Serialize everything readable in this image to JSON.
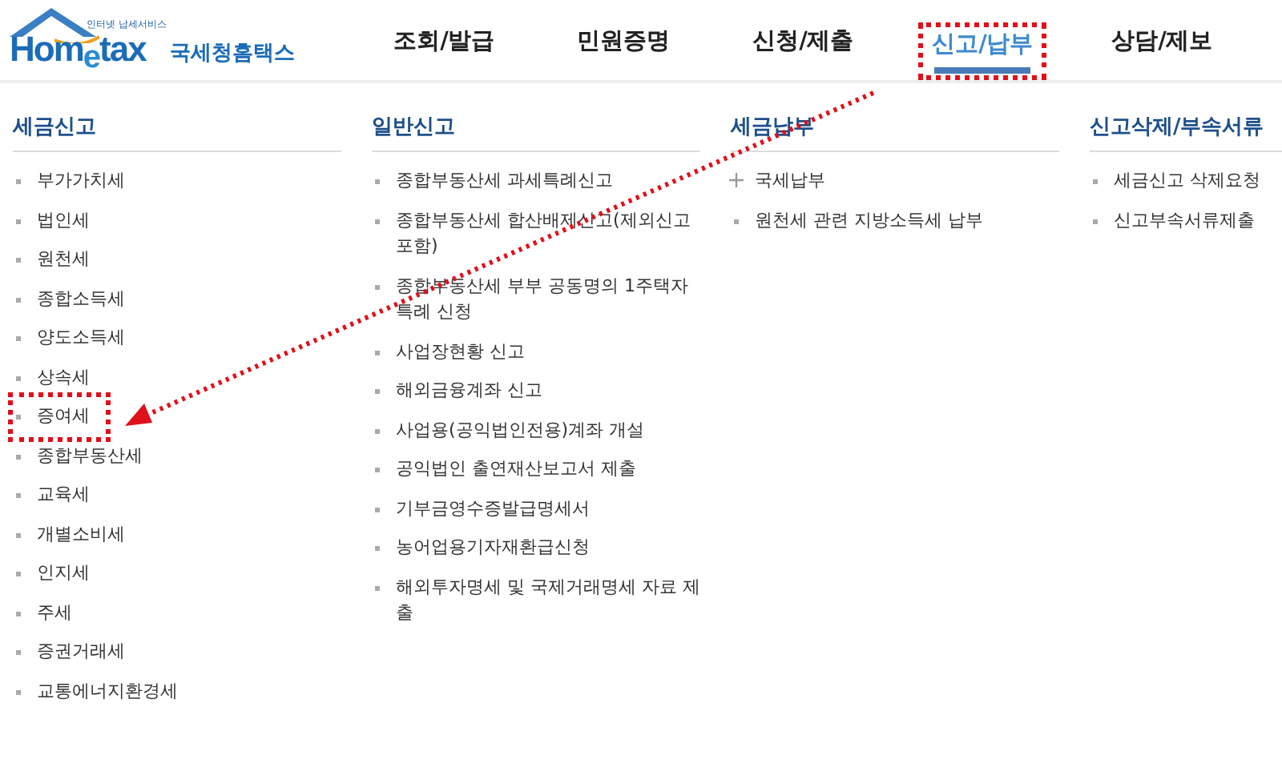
{
  "logo": {
    "tagline": "인터넷 납세서비스",
    "wordmark": "Hom$_{e}$tax",
    "name": "국세청홈택스"
  },
  "nav": [
    {
      "label": "조회/발급",
      "selected": false,
      "highlighted": false
    },
    {
      "label": "민원증명",
      "selected": false,
      "highlighted": false
    },
    {
      "label": "신청/제출",
      "selected": false,
      "highlighted": false
    },
    {
      "label": "신고/납부",
      "selected": true,
      "highlighted": true
    },
    {
      "label": "상담/제보",
      "selected": false,
      "highlighted": false
    }
  ],
  "columns": [
    {
      "heading": "세금신고",
      "items": [
        {
          "label": "부가가치세",
          "kind": "link",
          "highlighted": false
        },
        {
          "label": "법인세",
          "kind": "link",
          "highlighted": false
        },
        {
          "label": "원천세",
          "kind": "link",
          "highlighted": false
        },
        {
          "label": "종합소득세",
          "kind": "link",
          "highlighted": false
        },
        {
          "label": "양도소득세",
          "kind": "link",
          "highlighted": false
        },
        {
          "label": "상속세",
          "kind": "link",
          "highlighted": false
        },
        {
          "label": "증여세",
          "kind": "link",
          "highlighted": true
        },
        {
          "label": "종합부동산세",
          "kind": "link",
          "highlighted": false
        },
        {
          "label": "교육세",
          "kind": "link",
          "highlighted": false
        },
        {
          "label": "개별소비세",
          "kind": "link",
          "highlighted": false
        },
        {
          "label": "인지세",
          "kind": "link",
          "highlighted": false
        },
        {
          "label": "주세",
          "kind": "link",
          "highlighted": false
        },
        {
          "label": "증권거래세",
          "kind": "link",
          "highlighted": false
        },
        {
          "label": "교통에너지환경세",
          "kind": "link",
          "highlighted": false
        }
      ]
    },
    {
      "heading": "일반신고",
      "items": [
        {
          "label": "종합부동산세 과세특례신고",
          "kind": "link",
          "highlighted": false
        },
        {
          "label": "종합부동산세 합산배제신고(제외신고 포함)",
          "kind": "link",
          "highlighted": false
        },
        {
          "label": "종합부동산세 부부 공동명의 1주택자 특례 신청",
          "kind": "link",
          "highlighted": false
        },
        {
          "label": "사업장현황 신고",
          "kind": "link",
          "highlighted": false
        },
        {
          "label": "해외금융계좌 신고",
          "kind": "link",
          "highlighted": false
        },
        {
          "label": "사업용(공익법인전용)계좌 개설",
          "kind": "link",
          "highlighted": false
        },
        {
          "label": "공익법인 출연재산보고서 제출",
          "kind": "link",
          "highlighted": false
        },
        {
          "label": "기부금영수증발급명세서",
          "kind": "link",
          "highlighted": false
        },
        {
          "label": "농어업용기자재환급신청",
          "kind": "link",
          "highlighted": false
        },
        {
          "label": "해외투자명세 및 국제거래명세 자료 제출",
          "kind": "link",
          "highlighted": false
        }
      ]
    },
    {
      "heading": "세금납부",
      "items": [
        {
          "label": "국세납부",
          "kind": "expandable",
          "highlighted": false
        },
        {
          "label": "원천세 관련 지방소득세 납부",
          "kind": "link",
          "highlighted": false
        }
      ]
    },
    {
      "heading": "신고삭제/부속서류",
      "items": [
        {
          "label": "세금신고 삭제요청",
          "kind": "link",
          "highlighted": false
        },
        {
          "label": "신고부속서류제출",
          "kind": "link",
          "highlighted": false
        }
      ]
    }
  ]
}
